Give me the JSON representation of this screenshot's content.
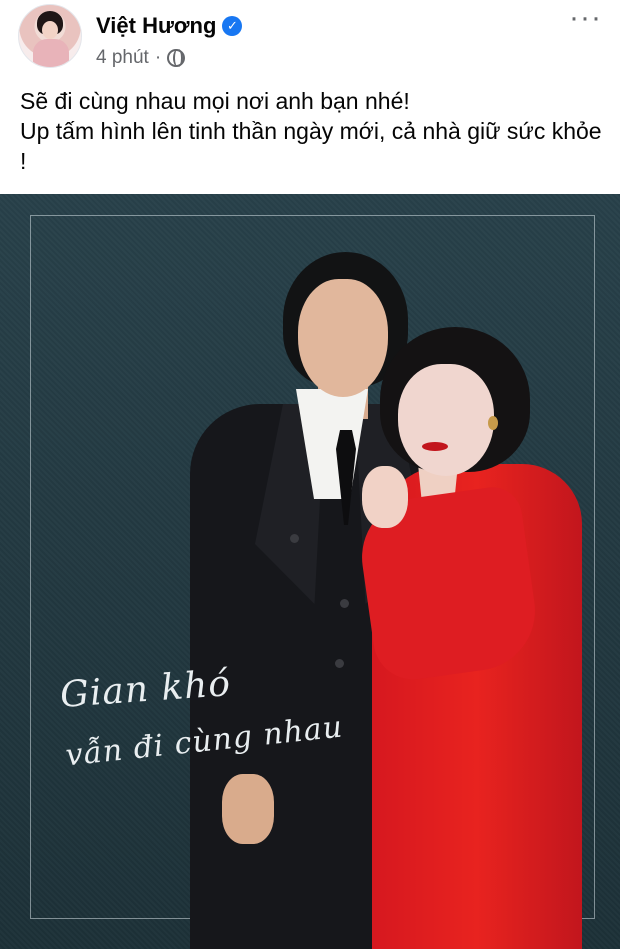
{
  "post": {
    "author": "Việt Hương",
    "time": "4 phút",
    "separator": "·",
    "more_label": "···",
    "caption_lines": [
      "Sẽ đi cùng nhau mọi nơi anh bạn nhé!",
      "Up tấm hình lên tinh thần ngày mới, cả nhà giữ sức khỏe !"
    ]
  },
  "photo": {
    "script_line_1": "Gian khó",
    "script_line_2": "vẫn đi cùng nhau"
  }
}
